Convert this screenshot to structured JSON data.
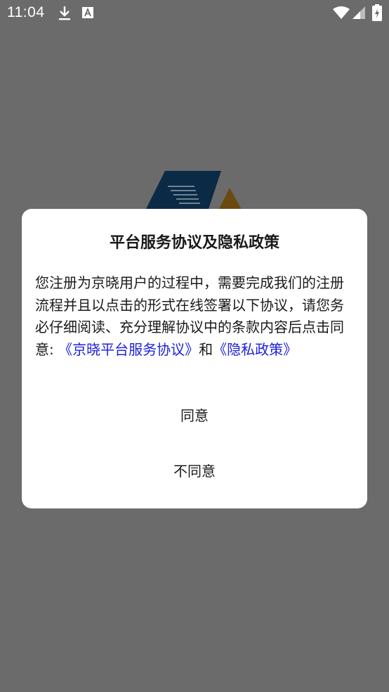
{
  "status_bar": {
    "time": "11:04",
    "icons": [
      "download-icon",
      "text-a-icon",
      "wifi-icon",
      "signal-icon",
      "battery-charging-icon"
    ]
  },
  "background": {
    "logo": "app-logo-icon",
    "overlay_color": "#6b6b6b"
  },
  "dialog": {
    "title": "平台服务协议及隐私政策",
    "body_text": "您注册为京晓用户的过程中，需要完成我们的注册流程并且以点击的形式在线签署以下协议，请您务必仔细阅读、充分理解协议中的条款内容后点击同意: ",
    "service_link": "《京晓平台服务协议》",
    "conjunction": "和",
    "privacy_link": "《隐私政策》",
    "agree_label": "同意",
    "disagree_label": "不同意",
    "link_color": "#1e22d8"
  }
}
